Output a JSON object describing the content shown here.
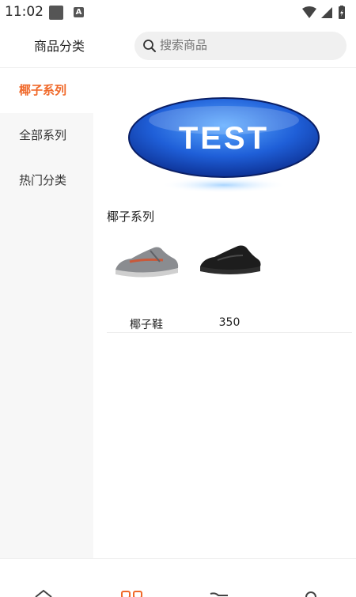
{
  "status_bar": {
    "time": "11:02",
    "app_icon_letter": "A"
  },
  "header": {
    "title": "商品分类",
    "search_placeholder": "搜索商品"
  },
  "sidebar": {
    "items": [
      {
        "label": "椰子系列",
        "active": true
      },
      {
        "label": "全部系列",
        "active": false
      },
      {
        "label": "热门分类",
        "active": false
      }
    ]
  },
  "banner": {
    "text": "TEST"
  },
  "section": {
    "title": "椰子系列",
    "products": [
      {
        "name": "椰子鞋",
        "color": "grey"
      },
      {
        "name": "350",
        "color": "black"
      }
    ]
  },
  "colors": {
    "accent": "#f0692a",
    "sidebar_bg": "#f7f7f7"
  },
  "bottom_tabs": [
    {
      "icon": "home-icon"
    },
    {
      "icon": "category-icon"
    },
    {
      "icon": "cart-icon"
    },
    {
      "icon": "user-icon"
    }
  ]
}
